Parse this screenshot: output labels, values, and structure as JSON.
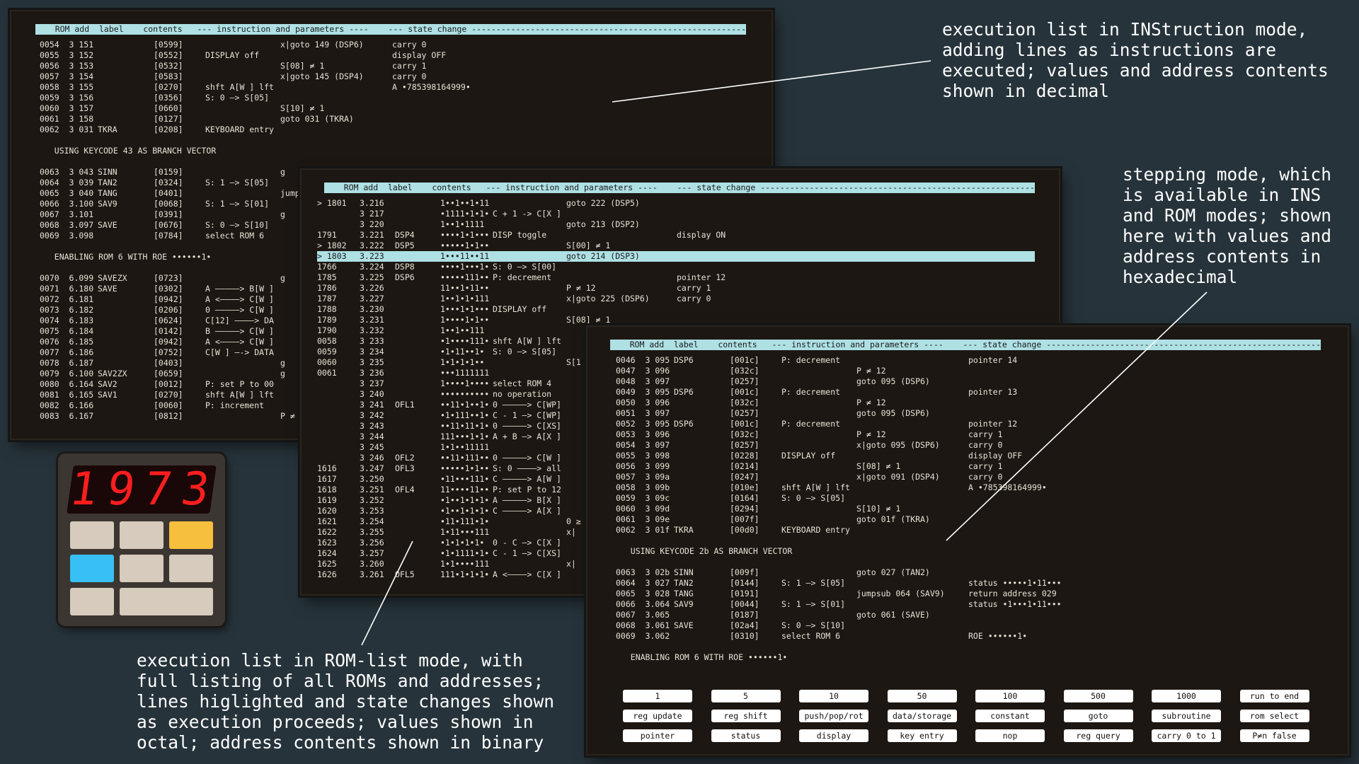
{
  "panel1": {
    "header": "    ROM add  label    contents   --- instruction and parameters ----    --- state change -------------------------------------------------------------------------------------------",
    "rows": [
      [
        "0054  3 151",
        "",
        "[0599]",
        "",
        "x|goto 149 (DSP6)",
        "carry 0"
      ],
      [
        "0055  3 152",
        "",
        "[0552]",
        "DISPLAY off",
        "",
        "display OFF"
      ],
      [
        "0056  3 153",
        "",
        "[0532]",
        "",
        "S[08] ≠ 1",
        "carry 1"
      ],
      [
        "0057  3 154",
        "",
        "[0583]",
        "",
        "x|goto 145 (DSP4)",
        "carry 0"
      ],
      [
        "0058  3 155",
        "",
        "[0270]",
        "shft A[W ] lft",
        "",
        "A •785398164999•"
      ],
      [
        "0059  3 156",
        "",
        "[0356]",
        "S: 0 —> S[05]",
        "",
        ""
      ],
      [
        "0060  3 157",
        "",
        "[0660]",
        "",
        "S[10] ≠ 1",
        ""
      ],
      [
        "0061  3 158",
        "",
        "[0127]",
        "",
        "goto 031 (TKRA)",
        ""
      ],
      [
        "0062  3 031",
        "TKRA",
        "[0208]",
        "KEYBOARD entry",
        "",
        ""
      ],
      [
        "",
        "",
        "",
        "",
        "",
        ""
      ],
      [
        "   USING KEYCODE 43 AS BRANCH VECTOR",
        "",
        "",
        "",
        "",
        ""
      ],
      [
        "",
        "",
        "",
        "",
        "",
        ""
      ],
      [
        "0063  3 043",
        "SINN",
        "[0159]",
        "",
        "g",
        ""
      ],
      [
        "0064  3 039",
        "TAN2",
        "[0324]",
        "S: 1 —> S[05]",
        "",
        ""
      ],
      [
        "0065  3 040",
        "TANG",
        "[0401]",
        "",
        "jump",
        ""
      ],
      [
        "0066  3.100",
        "SAV9",
        "[0068]",
        "S: 1 —> S[01]",
        "",
        ""
      ],
      [
        "0067  3.101",
        "",
        "[0391]",
        "",
        "g",
        ""
      ],
      [
        "0068  3.097",
        "SAVE",
        "[0676]",
        "S: 0 —> S[10]",
        "",
        ""
      ],
      [
        "0069  3.098",
        "",
        "[0784]",
        "select ROM 6",
        "",
        ""
      ],
      [
        "",
        "",
        "",
        "",
        "",
        ""
      ],
      [
        "   ENABLING ROM 6 WITH ROE ••••••1•",
        "",
        "",
        "",
        "",
        ""
      ],
      [
        "",
        "",
        "",
        "",
        "",
        ""
      ],
      [
        "0070  6.099",
        "SAVEZX",
        "[0723]",
        "",
        "g",
        ""
      ],
      [
        "0071  6.180",
        "SAVE",
        "[0302]",
        "A —————> B[W ]",
        "",
        ""
      ],
      [
        "0072  6.181",
        "",
        "[0942]",
        "A <————> C[W ]",
        "",
        ""
      ],
      [
        "0073  6.182",
        "",
        "[0206]",
        "0 —————> C[W ]",
        "",
        ""
      ],
      [
        "0074  6.183",
        "",
        "[0624]",
        "C[12] ————> DA",
        "",
        ""
      ],
      [
        "0075  6.184",
        "",
        "[0142]",
        "B —————> C[W ]",
        "",
        ""
      ],
      [
        "0076  6.185",
        "",
        "[0942]",
        "A <————> C[W ]",
        "",
        ""
      ],
      [
        "0077  6.186",
        "",
        "[0752]",
        "C[W ] —-> DATA",
        "",
        ""
      ],
      [
        "0078  6.187",
        "",
        "[0403]",
        "",
        "g",
        ""
      ],
      [
        "0079  6.100",
        "SAV2ZX",
        "[0659]",
        "",
        "g",
        ""
      ],
      [
        "0080  6.164",
        "SAV2",
        "[0012]",
        "P: set P to 00",
        "",
        ""
      ],
      [
        "0081  6.165",
        "SAV1",
        "[0270]",
        "shft A[W ] lft",
        "",
        ""
      ],
      [
        "0082  6.166",
        "",
        "[0060]",
        "P: increment",
        "",
        ""
      ],
      [
        "0083  6.167",
        "",
        "[0812]",
        "",
        "P ≠",
        ""
      ]
    ]
  },
  "panel2": {
    "header": "    ROM add  label    contents   --- instruction and parameters ----    --- state change -----------------------------------------------------------------------------------",
    "highlight_row": 5,
    "rows": [
      [
        "> 1801",
        "3.216",
        "",
        "1••1••1•11",
        "",
        "goto 222 (DSP5)",
        ""
      ],
      [
        "",
        "3 217",
        "",
        "•1111•1•1•",
        "C + 1 -> C[X ]",
        "",
        ""
      ],
      [
        "",
        "3 220",
        "",
        "1••1•1111",
        "",
        "goto 213 (DSP2)",
        ""
      ],
      [
        "1791",
        "3.221",
        "DSP4",
        "••••1•1•••",
        "DISP toggle",
        "",
        "display ON"
      ],
      [
        "> 1802",
        "3.222",
        "DSP5",
        "•••••1•1••",
        "",
        "S[00] ≠ 1",
        ""
      ],
      [
        "> 1803",
        "3.223",
        "",
        "1•••11••11",
        "",
        "goto 214 (DSP3)",
        ""
      ],
      [
        "1766",
        "3.224",
        "DSP8",
        "••••1•••1•",
        "S: 0 —> S[00]",
        "",
        ""
      ],
      [
        "1785",
        "3.225",
        "DSP6",
        "•••••111••",
        "P: decrement",
        "",
        "pointer 12"
      ],
      [
        "1786",
        "3.226",
        "",
        "11••1•11••",
        "",
        "P ≠ 12",
        "carry 1"
      ],
      [
        "1787",
        "3.227",
        "",
        "1••1•1•111",
        "",
        "x|goto 225 (DSP6)",
        "carry 0"
      ],
      [
        "1788",
        "3.230",
        "",
        "1•••1•1•••",
        "DISPLAY off",
        "",
        ""
      ],
      [
        "1789",
        "3.231",
        "",
        "1••••1•1••",
        "",
        "S[08] ≠ 1",
        ""
      ],
      [
        "1790",
        "3.232",
        "",
        "1••1••111",
        "",
        "",
        ""
      ],
      [
        "0058",
        "3 233",
        "",
        "•1••••111•",
        "shft A[W ] lft",
        "",
        ""
      ],
      [
        "0059",
        "3 234",
        "",
        "•1•11••1•",
        "S: 0 —> S[05]",
        "",
        ""
      ],
      [
        "0060",
        "3 235",
        "",
        "1•1•1•1••",
        "",
        "S[1",
        ""
      ],
      [
        "0061",
        "3 236",
        "",
        "•••1111111",
        "",
        "",
        ""
      ],
      [
        "",
        "3 237",
        "",
        "1••••1••••",
        "select ROM 4",
        "",
        ""
      ],
      [
        "",
        "3 240",
        "",
        "••••••••••",
        "no operation",
        "",
        ""
      ],
      [
        "",
        "3 241",
        "OFL1",
        "••11•1••1•",
        "0 —————> C[WP]",
        "",
        ""
      ],
      [
        "",
        "3 242",
        "",
        "•1•111••1•",
        "C - 1 —> C[WP]",
        "",
        ""
      ],
      [
        "",
        "3 243",
        "",
        "••11•11•1•",
        "0 —————> C[XS]",
        "",
        ""
      ],
      [
        "",
        "3 244",
        "",
        "111•••1•1•",
        "A + B —> A[X ]",
        "",
        ""
      ],
      [
        "",
        "3 245",
        "",
        "1•1••11111",
        "",
        "",
        ""
      ],
      [
        "",
        "3 246",
        "OFL2",
        "••11•111••",
        "0 —————> C[W ]",
        "",
        ""
      ],
      [
        "1616",
        "3.247",
        "OFL3",
        "•••••1•1••",
        "S: 0 ————> all",
        "",
        ""
      ],
      [
        "1617",
        "3.250",
        "",
        "•11•••111•",
        "C —————> A[W ]",
        "",
        ""
      ],
      [
        "1618",
        "3.251",
        "OFL4",
        "11••••11••",
        "P: set P to 12",
        "",
        ""
      ],
      [
        "1619",
        "3.252",
        "",
        "•1••1•1•1•",
        "A —————> B[X ]",
        "",
        ""
      ],
      [
        "1620",
        "3.253",
        "",
        "•1••1•1•1•",
        "C —————> A[X ]",
        "",
        ""
      ],
      [
        "1621",
        "3.254",
        "",
        "•11•111•1•",
        "",
        "0 ≥",
        ""
      ],
      [
        "1622",
        "3.255",
        "",
        "1•11•••111",
        "",
        "x|",
        ""
      ],
      [
        "1623",
        "3.256",
        "",
        "•1•1•1•1•",
        "0 - C —> C[X ]",
        "",
        ""
      ],
      [
        "1624",
        "3.257",
        "",
        "•1•1111•1•",
        "C - 1 —> C[XS]",
        "",
        ""
      ],
      [
        "1625",
        "3.260",
        "",
        "1•1••••111",
        "",
        "x|",
        ""
      ],
      [
        "1626",
        "3.261",
        "OFL5",
        "111•1•1•1•",
        "A <————> C[X ]",
        "",
        ""
      ]
    ]
  },
  "panel3": {
    "header": "    ROM add  label    contents   --- instruction and parameters ----    --- state change -------------------------------------------------------------------------",
    "rows": [
      [
        "0046  3 095",
        "DSP6",
        "[001c]",
        "P: decrement",
        "",
        "pointer 14"
      ],
      [
        "0047  3 096",
        "",
        "[032c]",
        "",
        "P ≠ 12",
        ""
      ],
      [
        "0048  3 097",
        "",
        "[0257]",
        "",
        "goto 095 (DSP6)",
        ""
      ],
      [
        "0049  3 095",
        "DSP6",
        "[001c]",
        "P: decrement",
        "",
        "pointer 13"
      ],
      [
        "0050  3 096",
        "",
        "[032c]",
        "",
        "P ≠ 12",
        ""
      ],
      [
        "0051  3 097",
        "",
        "[0257]",
        "",
        "goto 095 (DSP6)",
        ""
      ],
      [
        "0052  3 095",
        "DSP6",
        "[001c]",
        "P: decrement",
        "",
        "pointer 12"
      ],
      [
        "0053  3 096",
        "",
        "[032c]",
        "",
        "P ≠ 12",
        "carry 1"
      ],
      [
        "0054  3 097",
        "",
        "[0257]",
        "",
        "x|goto 095 (DSP6)",
        "carry 0"
      ],
      [
        "0055  3 098",
        "",
        "[0228]",
        "DISPLAY off",
        "",
        "display OFF"
      ],
      [
        "0056  3 099",
        "",
        "[0214]",
        "",
        "S[08] ≠ 1",
        "carry 1"
      ],
      [
        "0057  3 09a",
        "",
        "[0247]",
        "",
        "x|goto 091 (DSP4)",
        "carry 0"
      ],
      [
        "0058  3 09b",
        "",
        "[010e]",
        "shft A[W ] lft",
        "",
        "A •785398164999•"
      ],
      [
        "0059  3 09c",
        "",
        "[0164]",
        "S: 0 —> S[05]",
        "",
        ""
      ],
      [
        "0060  3 09d",
        "",
        "[0294]",
        "",
        "S[10] ≠ 1",
        ""
      ],
      [
        "0061  3 09e",
        "",
        "[007f]",
        "",
        "goto 01f (TKRA)",
        ""
      ],
      [
        "0062  3 01f",
        "TKRA",
        "[00d0]",
        "KEYBOARD entry",
        "",
        ""
      ],
      [
        "",
        "",
        "",
        "",
        "",
        ""
      ],
      [
        "   USING KEYCODE 2b AS BRANCH VECTOR",
        "",
        "",
        "",
        "",
        ""
      ],
      [
        "",
        "",
        "",
        "",
        "",
        ""
      ],
      [
        "0063  3 02b",
        "SINN",
        "[009f]",
        "",
        "goto 027 (TAN2)",
        ""
      ],
      [
        "0064  3 027",
        "TAN2",
        "[0144]",
        "S: 1 —> S[05]",
        "",
        "status •••••1•11•••"
      ],
      [
        "0065  3 028",
        "TANG",
        "[0191]",
        "",
        "jumpsub 064 (SAV9)",
        "return address 029"
      ],
      [
        "0066  3.064",
        "SAV9",
        "[0044]",
        "S: 1 —> S[01]",
        "",
        "status •1•••1•11•••"
      ],
      [
        "0067  3.065",
        "",
        "[0187]",
        "",
        "goto 061 (SAVE)",
        ""
      ],
      [
        "0068  3.061",
        "SAVE",
        "[02a4]",
        "S: 0 —> S[10]",
        "",
        ""
      ],
      [
        "0069  3.062",
        "",
        "[0310]",
        "select ROM 6",
        "",
        "ROE ••••••1•"
      ],
      [
        "",
        "",
        "",
        "",
        "",
        ""
      ],
      [
        "   ENABLING ROM 6 WITH ROE ••••••1•",
        "",
        "",
        "",
        "",
        ""
      ]
    ],
    "buttons": [
      [
        "1",
        "5",
        "10",
        "50",
        "100",
        "500",
        "1000",
        "run to end"
      ],
      [
        "reg update",
        "reg shift",
        "push/pop/rot",
        "data/storage",
        "constant",
        "goto",
        "subroutine",
        "rom select"
      ],
      [
        "pointer",
        "status",
        "display",
        "key entry",
        "nop",
        "reg query",
        "carry 0 to 1",
        "P≠n false"
      ]
    ]
  },
  "notes": {
    "ins": "execution list in INStruction mode,\nadding lines as instructions are\nexecuted; values and address contents\nshown in decimal",
    "stepping": "stepping mode, which\nis available in INS\nand ROM modes; shown\nhere with values and\naddress contents in\nhexadecimal",
    "rom": "execution list in ROM-list mode, with\nfull listing of all ROMs and addresses;\nlines higlighted and state changes shown\nas execution proceeds; values shown in\noctal; address contents shown in binary"
  },
  "calculator": {
    "display": "1973",
    "colors": {
      "key": "#d6cbbd",
      "orange": "#f7bf3e",
      "blue": "#38bff3",
      "segment": "#ff1e1e"
    }
  }
}
